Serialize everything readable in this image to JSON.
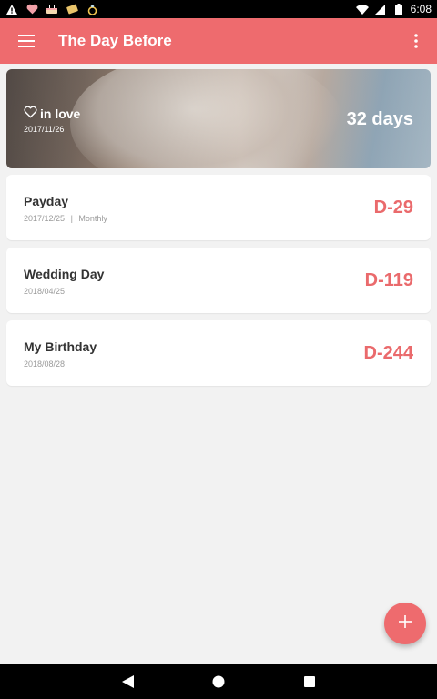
{
  "statusbar": {
    "time": "6:08",
    "icons": [
      "warning-icon",
      "heart-icon",
      "cake-icon",
      "ticket-icon",
      "ring-icon",
      "wifi-icon",
      "signal-icon",
      "battery-icon"
    ]
  },
  "appbar": {
    "title": "The Day Before",
    "menu_icon": "hamburger-menu-icon",
    "overflow_icon": "more-vert-icon"
  },
  "hero": {
    "label": "in love",
    "date": "2017/11/26",
    "days": "32 days"
  },
  "events": [
    {
      "name": "Payday",
      "date": "2017/12/25",
      "repeat": "Monthly",
      "separator": "|",
      "dday": "D-29"
    },
    {
      "name": "Wedding Day",
      "date": "2018/04/25",
      "dday": "D-119"
    },
    {
      "name": "My Birthday",
      "date": "2018/08/28",
      "dday": "D-244"
    }
  ],
  "fab": {
    "icon": "plus-icon"
  },
  "colors": {
    "accent": "#ee6b6e",
    "dday": "#ea6a6c",
    "background": "#f2f2f2"
  }
}
